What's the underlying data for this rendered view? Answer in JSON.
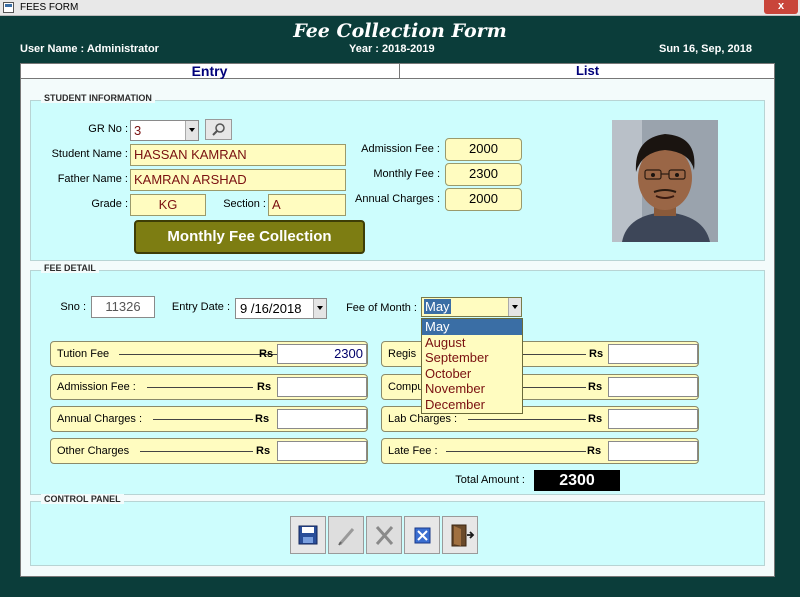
{
  "window": {
    "title": "FEES FORM",
    "close_label": "x"
  },
  "header": {
    "title": "Fee Collection Form",
    "user": "User Name :  Administrator",
    "year": "Year : 2018-2019",
    "date": "Sun 16, Sep, 2018"
  },
  "tabs": {
    "entry": "Entry",
    "list": "List"
  },
  "student": {
    "section_title": "STUDENT INFORMATION",
    "grno_label": "GR No :",
    "grno": "3",
    "name_label": "Student Name :",
    "name": "HASSAN KAMRAN",
    "father_label": "Father Name :",
    "father": "KAMRAN ARSHAD",
    "grade_label": "Grade :",
    "grade": "KG",
    "section_label": "Section :",
    "section": "A",
    "admission_fee_label": "Admission Fee :",
    "admission_fee": "2000",
    "monthly_fee_label": "Monthly Fee :",
    "monthly_fee": "2300",
    "annual_charges_label": "Annual Charges :",
    "annual_charges": "2000",
    "action_button": "Monthly Fee Collection"
  },
  "fee": {
    "section_title": "FEE DETAIL",
    "sno_label": "Sno :",
    "sno": "11326",
    "entry_date_label": "Entry Date :",
    "entry_date": "9 /16/2018",
    "month_label": "Fee of Month :",
    "month": "May",
    "months": [
      "May",
      "August",
      "September",
      "October",
      "November",
      "December"
    ],
    "currency": "Rs",
    "rows_left": [
      {
        "label": "Tution Fee",
        "value": "2300"
      },
      {
        "label": "Admission Fee :",
        "value": ""
      },
      {
        "label": "Annual Charges :",
        "value": ""
      },
      {
        "label": "Other Charges",
        "value": ""
      }
    ],
    "rows_right": [
      {
        "label": "Regis",
        "value": ""
      },
      {
        "label": "Compu",
        "value": ""
      },
      {
        "label": "Lab Charges :",
        "value": ""
      },
      {
        "label": "Late Fee :",
        "value": ""
      }
    ],
    "total_label": "Total Amount :",
    "total": "2300"
  },
  "control": {
    "section_title": "CONTROL PANEL",
    "buttons": [
      "save-icon",
      "edit-icon",
      "delete-icon",
      "cancel-icon",
      "exit-icon"
    ]
  },
  "colors": {
    "accent": "#7d7d12",
    "panel": "#cdfdfd",
    "field": "#fffcc0"
  }
}
